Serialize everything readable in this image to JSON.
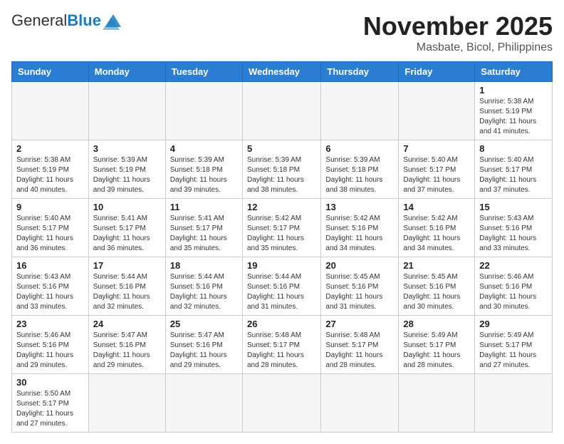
{
  "header": {
    "logo_general": "General",
    "logo_blue": "Blue",
    "month": "November 2025",
    "location": "Masbate, Bicol, Philippines"
  },
  "weekdays": [
    "Sunday",
    "Monday",
    "Tuesday",
    "Wednesday",
    "Thursday",
    "Friday",
    "Saturday"
  ],
  "days": {
    "1": {
      "sunrise": "5:38 AM",
      "sunset": "5:19 PM",
      "daylight": "11 hours and 41 minutes."
    },
    "2": {
      "sunrise": "5:38 AM",
      "sunset": "5:19 PM",
      "daylight": "11 hours and 40 minutes."
    },
    "3": {
      "sunrise": "5:39 AM",
      "sunset": "5:19 PM",
      "daylight": "11 hours and 39 minutes."
    },
    "4": {
      "sunrise": "5:39 AM",
      "sunset": "5:18 PM",
      "daylight": "11 hours and 39 minutes."
    },
    "5": {
      "sunrise": "5:39 AM",
      "sunset": "5:18 PM",
      "daylight": "11 hours and 38 minutes."
    },
    "6": {
      "sunrise": "5:39 AM",
      "sunset": "5:18 PM",
      "daylight": "11 hours and 38 minutes."
    },
    "7": {
      "sunrise": "5:40 AM",
      "sunset": "5:17 PM",
      "daylight": "11 hours and 37 minutes."
    },
    "8": {
      "sunrise": "5:40 AM",
      "sunset": "5:17 PM",
      "daylight": "11 hours and 37 minutes."
    },
    "9": {
      "sunrise": "5:40 AM",
      "sunset": "5:17 PM",
      "daylight": "11 hours and 36 minutes."
    },
    "10": {
      "sunrise": "5:41 AM",
      "sunset": "5:17 PM",
      "daylight": "11 hours and 36 minutes."
    },
    "11": {
      "sunrise": "5:41 AM",
      "sunset": "5:17 PM",
      "daylight": "11 hours and 35 minutes."
    },
    "12": {
      "sunrise": "5:42 AM",
      "sunset": "5:17 PM",
      "daylight": "11 hours and 35 minutes."
    },
    "13": {
      "sunrise": "5:42 AM",
      "sunset": "5:16 PM",
      "daylight": "11 hours and 34 minutes."
    },
    "14": {
      "sunrise": "5:42 AM",
      "sunset": "5:16 PM",
      "daylight": "11 hours and 34 minutes."
    },
    "15": {
      "sunrise": "5:43 AM",
      "sunset": "5:16 PM",
      "daylight": "11 hours and 33 minutes."
    },
    "16": {
      "sunrise": "5:43 AM",
      "sunset": "5:16 PM",
      "daylight": "11 hours and 33 minutes."
    },
    "17": {
      "sunrise": "5:44 AM",
      "sunset": "5:16 PM",
      "daylight": "11 hours and 32 minutes."
    },
    "18": {
      "sunrise": "5:44 AM",
      "sunset": "5:16 PM",
      "daylight": "11 hours and 32 minutes."
    },
    "19": {
      "sunrise": "5:44 AM",
      "sunset": "5:16 PM",
      "daylight": "11 hours and 31 minutes."
    },
    "20": {
      "sunrise": "5:45 AM",
      "sunset": "5:16 PM",
      "daylight": "11 hours and 31 minutes."
    },
    "21": {
      "sunrise": "5:45 AM",
      "sunset": "5:16 PM",
      "daylight": "11 hours and 30 minutes."
    },
    "22": {
      "sunrise": "5:46 AM",
      "sunset": "5:16 PM",
      "daylight": "11 hours and 30 minutes."
    },
    "23": {
      "sunrise": "5:46 AM",
      "sunset": "5:16 PM",
      "daylight": "11 hours and 29 minutes."
    },
    "24": {
      "sunrise": "5:47 AM",
      "sunset": "5:16 PM",
      "daylight": "11 hours and 29 minutes."
    },
    "25": {
      "sunrise": "5:47 AM",
      "sunset": "5:16 PM",
      "daylight": "11 hours and 29 minutes."
    },
    "26": {
      "sunrise": "5:48 AM",
      "sunset": "5:17 PM",
      "daylight": "11 hours and 28 minutes."
    },
    "27": {
      "sunrise": "5:48 AM",
      "sunset": "5:17 PM",
      "daylight": "11 hours and 28 minutes."
    },
    "28": {
      "sunrise": "5:49 AM",
      "sunset": "5:17 PM",
      "daylight": "11 hours and 28 minutes."
    },
    "29": {
      "sunrise": "5:49 AM",
      "sunset": "5:17 PM",
      "daylight": "11 hours and 27 minutes."
    },
    "30": {
      "sunrise": "5:50 AM",
      "sunset": "5:17 PM",
      "daylight": "11 hours and 27 minutes."
    }
  },
  "labels": {
    "sunrise": "Sunrise:",
    "sunset": "Sunset:",
    "daylight": "Daylight:"
  }
}
